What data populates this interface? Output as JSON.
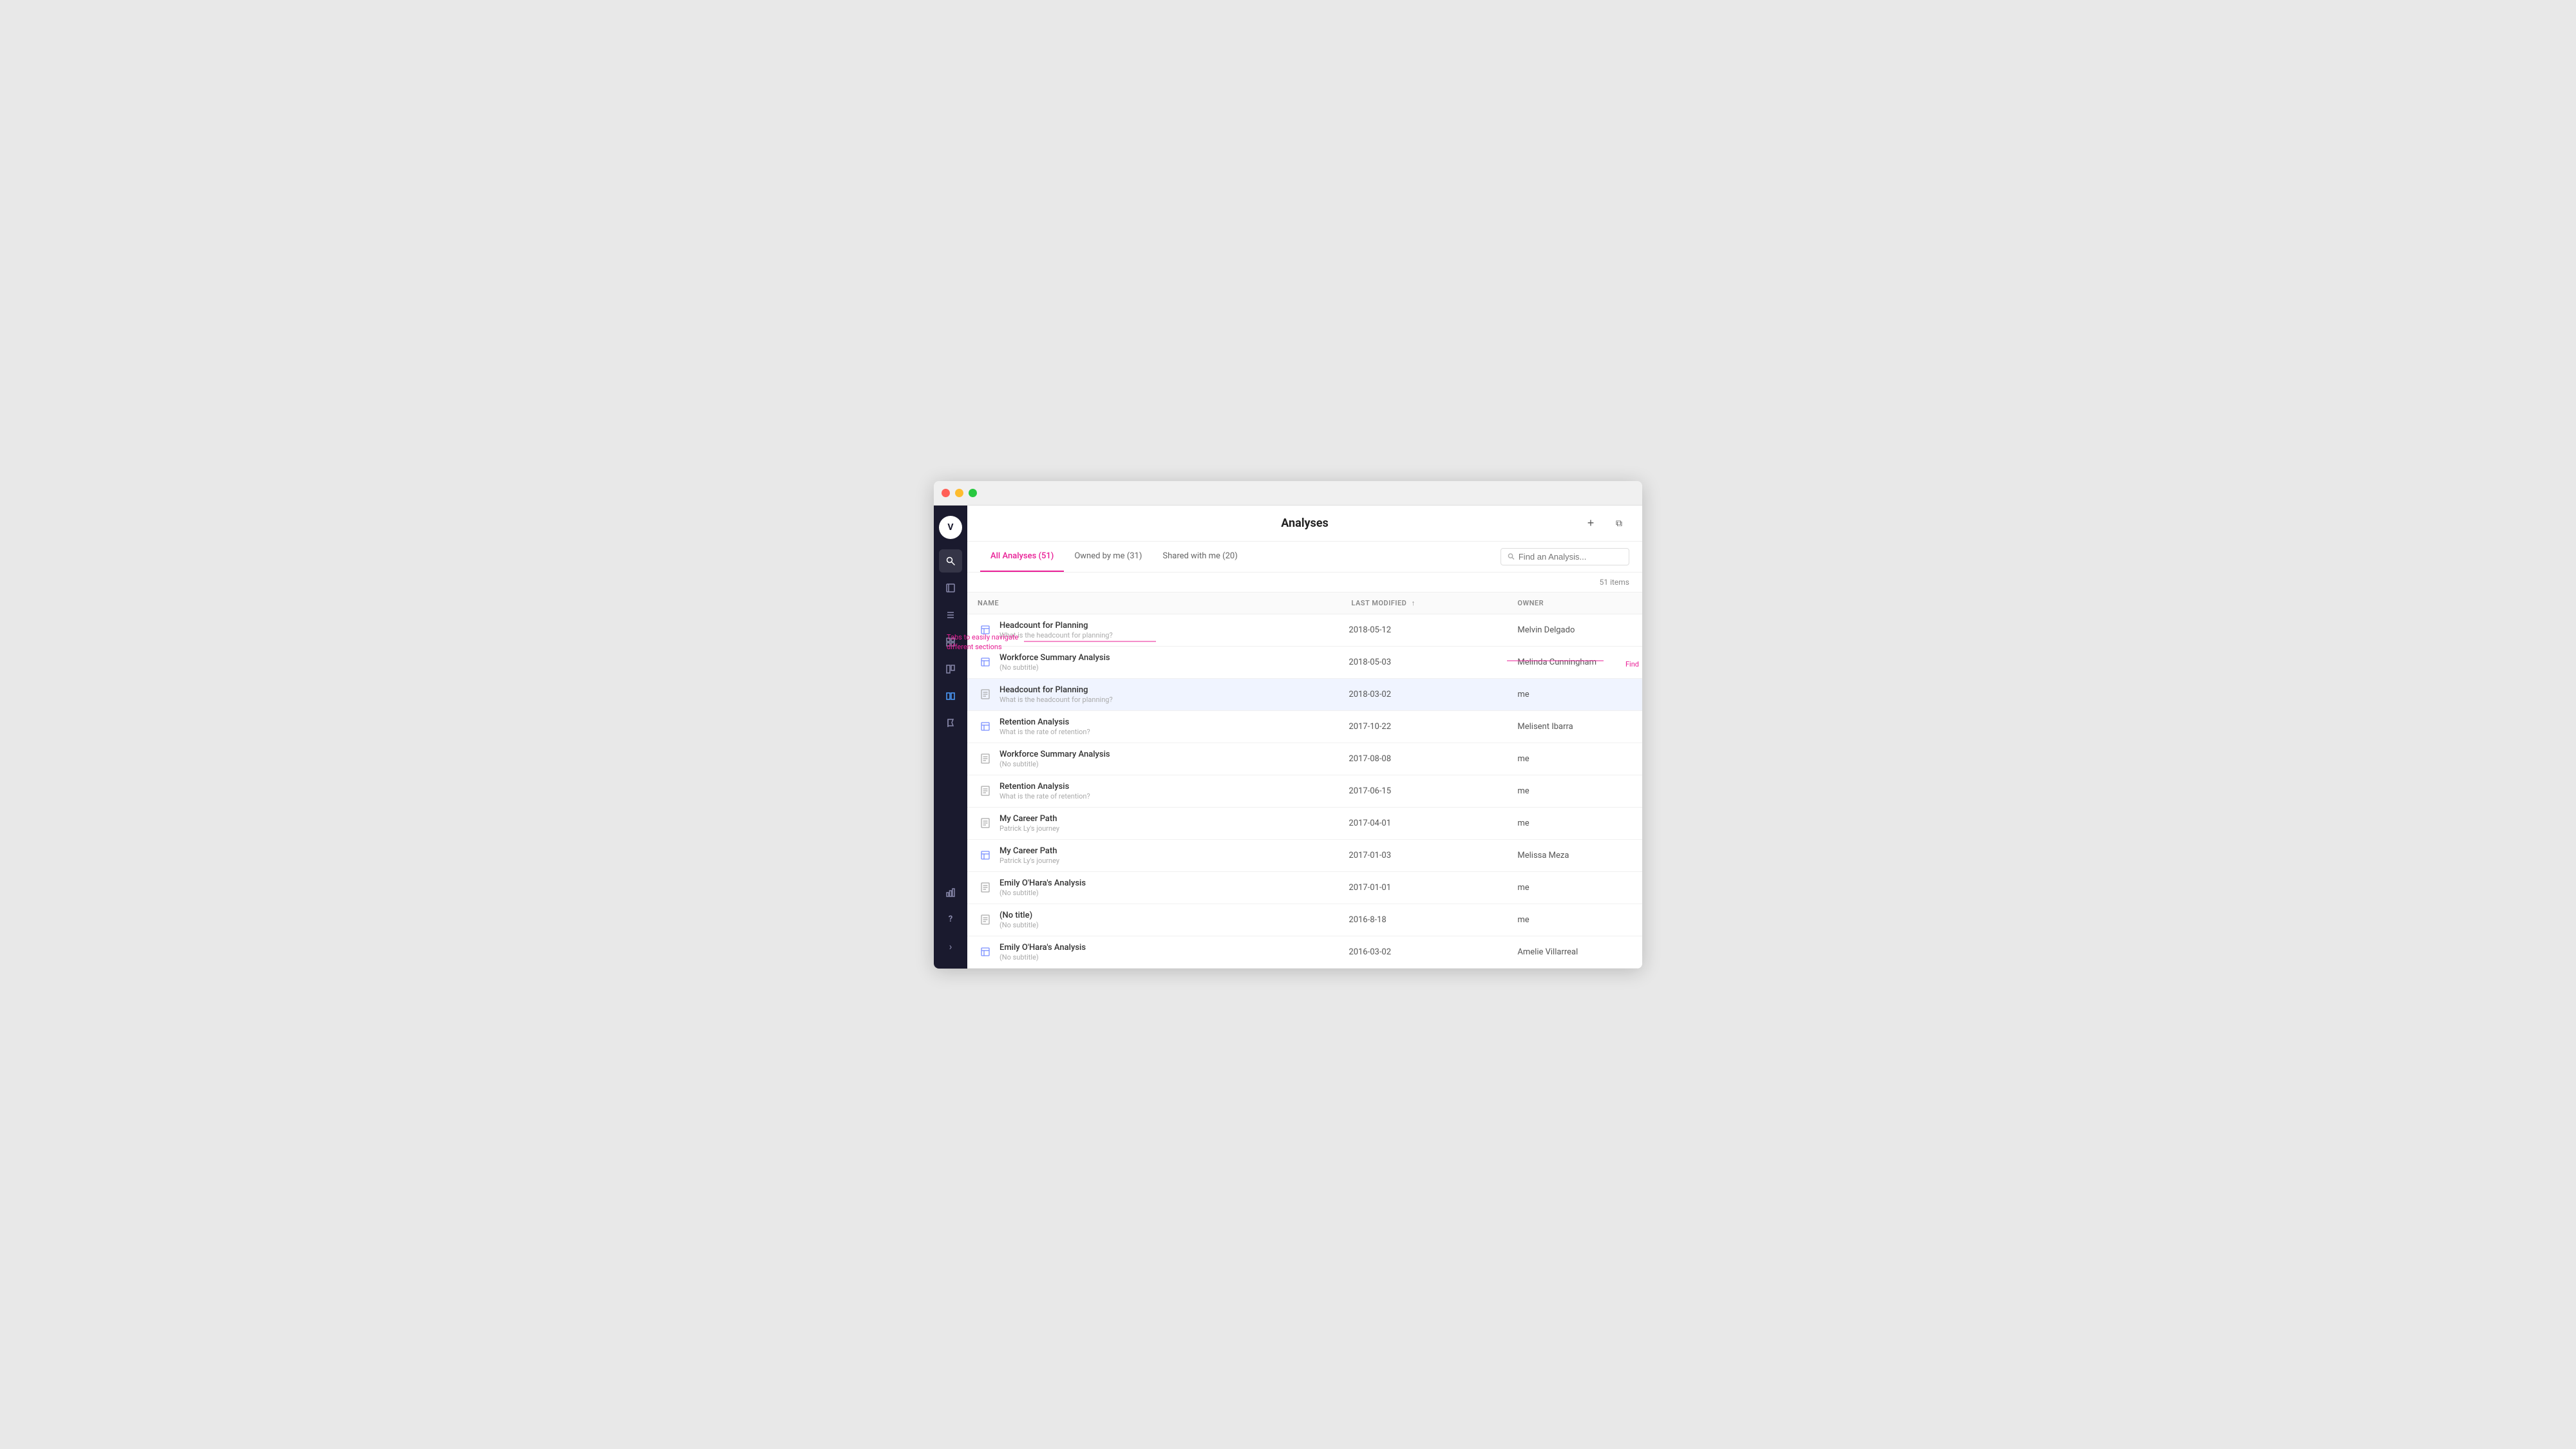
{
  "window": {
    "title": "Analyses"
  },
  "sidebar": {
    "avatar_initials": "V",
    "icons": [
      {
        "name": "search",
        "glyph": "🔍",
        "active": true
      },
      {
        "name": "book",
        "glyph": "📖",
        "active": false
      },
      {
        "name": "list",
        "glyph": "☰",
        "active": false
      },
      {
        "name": "grid-bar",
        "glyph": "▦",
        "active": false
      },
      {
        "name": "grid",
        "glyph": "⊞",
        "active": false
      },
      {
        "name": "layers",
        "glyph": "▣",
        "active": true,
        "highlighted": true
      },
      {
        "name": "flag",
        "glyph": "⚑",
        "active": false
      }
    ],
    "bottom_icons": [
      {
        "name": "chart",
        "glyph": "📊",
        "active": false
      },
      {
        "name": "help",
        "glyph": "?",
        "active": false
      },
      {
        "name": "expand",
        "glyph": "›",
        "active": false
      }
    ]
  },
  "header": {
    "title": "Analyses",
    "add_label": "+",
    "export_label": "⧉"
  },
  "tabs": [
    {
      "id": "all",
      "label": "All Analyses (51)",
      "active": true
    },
    {
      "id": "owned",
      "label": "Owned by me (31)",
      "active": false
    },
    {
      "id": "shared",
      "label": "Shared with me (20)",
      "active": false
    }
  ],
  "search": {
    "placeholder": "Find an Analysis..."
  },
  "item_count": "51 items",
  "table": {
    "columns": [
      {
        "id": "name",
        "label": "NAME",
        "sortable": false
      },
      {
        "id": "modified",
        "label": "LAST MODIFIED",
        "sortable": true
      },
      {
        "id": "owner",
        "label": "OWNER",
        "sortable": false
      }
    ],
    "rows": [
      {
        "id": 1,
        "icon_type": "shared",
        "name": "Headcount for Planning",
        "subtitle": "What is the headcount for planning?",
        "modified": "2018-05-12",
        "owner": "Melvin Delgado",
        "selected": false
      },
      {
        "id": 2,
        "icon_type": "shared",
        "name": "Workforce Summary Analysis",
        "subtitle": "(No subtitle)",
        "modified": "2018-05-03",
        "owner": "Melinda Cunningham",
        "selected": false
      },
      {
        "id": 3,
        "icon_type": "plain",
        "name": "Headcount for Planning",
        "subtitle": "What is the headcount for planning?",
        "modified": "2018-03-02",
        "owner": "me",
        "selected": true
      },
      {
        "id": 4,
        "icon_type": "shared",
        "name": "Retention Analysis",
        "subtitle": "What is the rate of retention?",
        "modified": "2017-10-22",
        "owner": "Melisent Ibarra",
        "selected": false
      },
      {
        "id": 5,
        "icon_type": "plain",
        "name": "Workforce Summary Analysis",
        "subtitle": "(No subtitle)",
        "modified": "2017-08-08",
        "owner": "me",
        "selected": false
      },
      {
        "id": 6,
        "icon_type": "plain",
        "name": "Retention Analysis",
        "subtitle": "What is the rate of retention?",
        "modified": "2017-06-15",
        "owner": "me",
        "selected": false
      },
      {
        "id": 7,
        "icon_type": "plain",
        "name": "My Career Path",
        "subtitle": "Patrick Ly's journey",
        "modified": "2017-04-01",
        "owner": "me",
        "selected": false
      },
      {
        "id": 8,
        "icon_type": "shared",
        "name": "My Career Path",
        "subtitle": "Patrick Ly's journey",
        "modified": "2017-01-03",
        "owner": "Melissa Meza",
        "selected": false
      },
      {
        "id": 9,
        "icon_type": "plain",
        "name": "Emily O'Hara's Analysis",
        "subtitle": "(No subtitle)",
        "modified": "2017-01-01",
        "owner": "me",
        "selected": false
      },
      {
        "id": 10,
        "icon_type": "plain",
        "name": "(No title)",
        "subtitle": "(No subtitle)",
        "modified": "2016-8-18",
        "owner": "me",
        "selected": false
      },
      {
        "id": 11,
        "icon_type": "shared",
        "name": "Emily O'Hara's Analysis",
        "subtitle": "(No subtitle)",
        "modified": "2016-03-02",
        "owner": "Amelie Villarreal",
        "selected": false
      }
    ]
  },
  "annotation": {
    "text": "Tabs to easily navigate different sections",
    "find_label": "Find"
  }
}
